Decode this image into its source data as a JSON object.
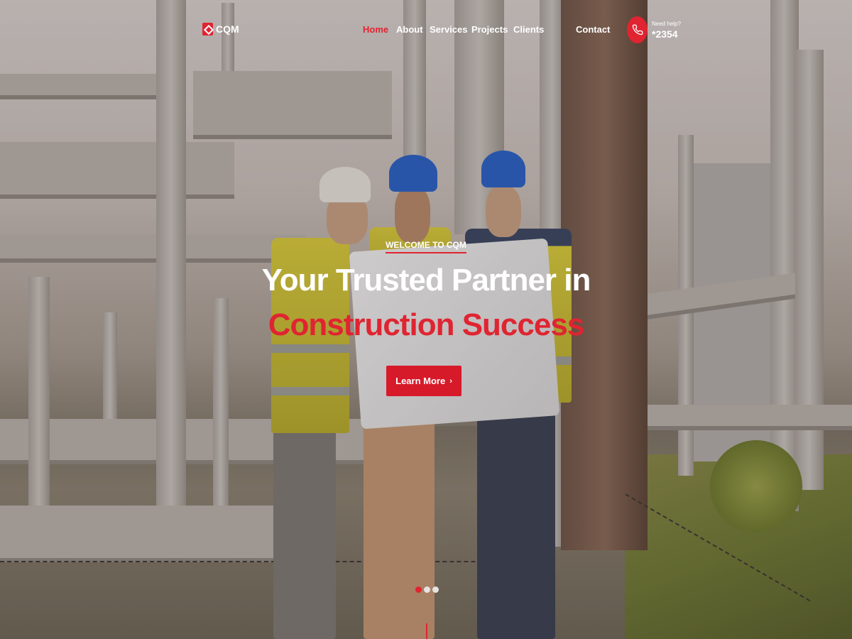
{
  "header": {
    "logo_text": "CQM",
    "nav": [
      {
        "label": "Home",
        "active": true
      },
      {
        "label": "About",
        "active": false
      },
      {
        "label": "Services",
        "active": false
      },
      {
        "label": "Projects",
        "active": false
      },
      {
        "label": "Clients",
        "active": false
      },
      {
        "label": "Contact",
        "active": false
      }
    ],
    "help": {
      "label": "Need help?",
      "number": "*2354"
    }
  },
  "hero": {
    "eyebrow": "WELCOME TO CQM",
    "title_line1": "Your Trusted Partner in",
    "title_line2": "Construction Success",
    "cta_label": "Learn More",
    "cta_arrow": "›",
    "slides": 3,
    "active_slide": 1
  },
  "colors": {
    "accent": "#e02431",
    "text_light": "#ffffff"
  },
  "icons": {
    "logo": "logo-mark-icon",
    "phone": "phone-icon",
    "cta": "chevron-right-icon"
  }
}
